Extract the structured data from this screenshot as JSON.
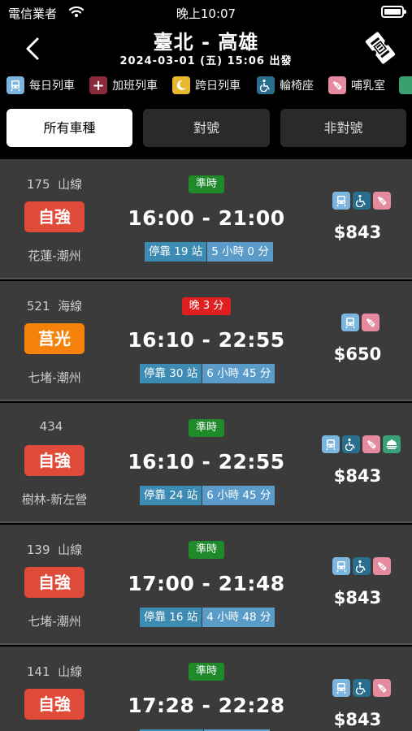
{
  "status_bar": {
    "carrier": "電信業者",
    "time": "晚上10:07"
  },
  "header": {
    "title": "臺北 - 高雄",
    "subtitle": "2024-03-01 (五) 15:06 出發"
  },
  "legend": [
    {
      "label": "每日列車",
      "icon": "train-icon",
      "color": "#7ab6e0"
    },
    {
      "label": "加班列車",
      "icon": "plus-icon",
      "color": "#8b2a3a"
    },
    {
      "label": "跨日列車",
      "icon": "moon-icon",
      "color": "#e8b830"
    },
    {
      "label": "輪椅座",
      "icon": "wheelchair-icon",
      "color": "#2a6e8e"
    },
    {
      "label": "哺乳室",
      "icon": "baby-bottle-icon",
      "color": "#e68aa0"
    }
  ],
  "filters": [
    {
      "label": "所有車種",
      "active": true
    },
    {
      "label": "對號",
      "active": false
    },
    {
      "label": "非對號",
      "active": false
    }
  ],
  "colors": {
    "ziqiang": "#e04a38",
    "juguang": "#f5820a",
    "on_time": "#1f8a2a",
    "late": "#e02020",
    "stops_bg": "#3d8bb2",
    "duration_bg": "#5a9bc9"
  },
  "trains": [
    {
      "number": "175",
      "line": "山線",
      "type": "自強",
      "route": "花蓮-潮州",
      "status": "準時",
      "late": false,
      "time": "16:00 - 21:00",
      "stops": "停靠 19 站",
      "duration": "5 小時 0 分",
      "icons": [
        "train-icon",
        "wheelchair-icon",
        "baby-bottle-icon"
      ],
      "price": "$843"
    },
    {
      "number": "521",
      "line": "海線",
      "type": "莒光",
      "route": "七堵-潮州",
      "status": "晚 3 分",
      "late": true,
      "time": "16:10 - 22:55",
      "stops": "停靠 30 站",
      "duration": "6 小時 45 分",
      "icons": [
        "train-icon",
        "baby-bottle-icon"
      ],
      "price": "$650"
    },
    {
      "number": "434",
      "line": "",
      "type": "自強",
      "route": "樹林-新左營",
      "status": "準時",
      "late": false,
      "time": "16:10 - 22:55",
      "stops": "停靠 24 站",
      "duration": "6 小時 45 分",
      "icons": [
        "train-icon",
        "wheelchair-icon",
        "baby-bottle-icon",
        "dining-icon"
      ],
      "price": "$843"
    },
    {
      "number": "139",
      "line": "山線",
      "type": "自強",
      "route": "七堵-潮州",
      "status": "準時",
      "late": false,
      "time": "17:00 - 21:48",
      "stops": "停靠 16 站",
      "duration": "4 小時 48 分",
      "icons": [
        "train-icon",
        "wheelchair-icon",
        "baby-bottle-icon"
      ],
      "price": "$843"
    },
    {
      "number": "141",
      "line": "山線",
      "type": "自強",
      "route": "",
      "status": "準時",
      "late": false,
      "time": "17:28 - 22:28",
      "stops": "",
      "duration": "",
      "icons": [
        "train-icon",
        "wheelchair-icon",
        "baby-bottle-icon"
      ],
      "price": "$843"
    }
  ]
}
